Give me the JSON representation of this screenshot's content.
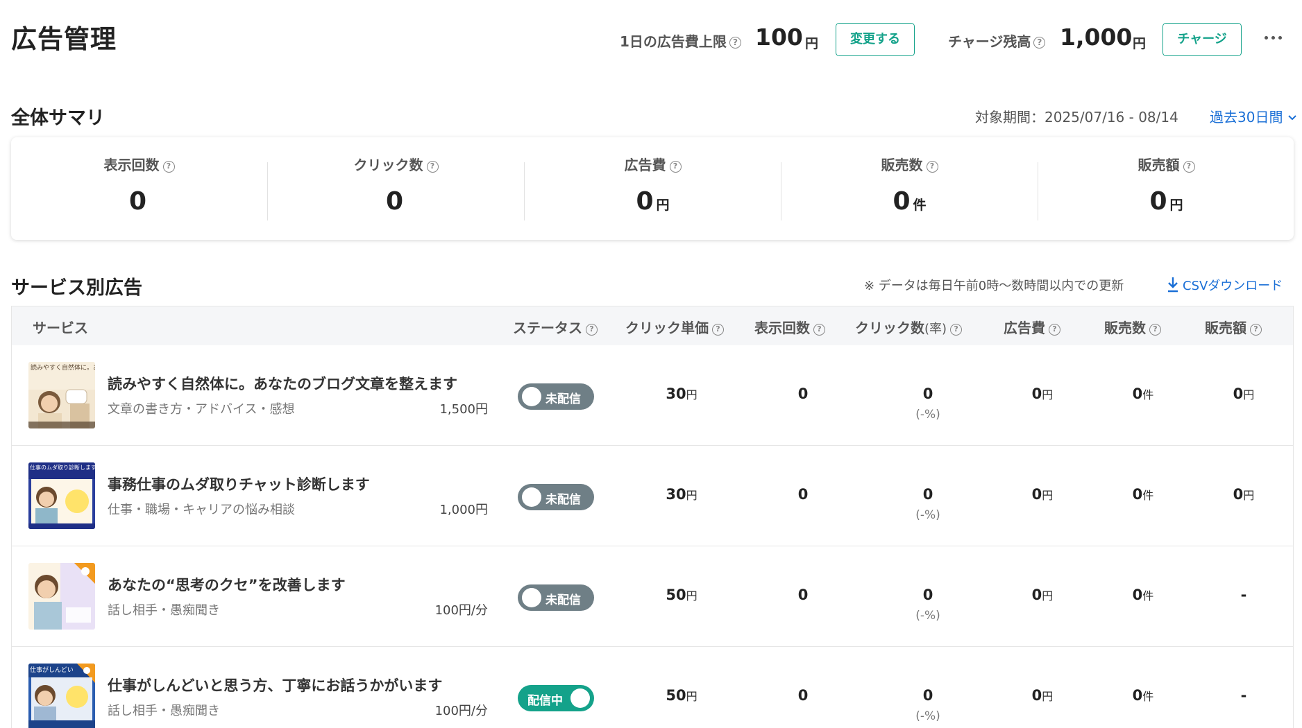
{
  "header": {
    "title": "広告管理",
    "daily_limit_label": "1日の広告費上限",
    "daily_limit_value": "100",
    "daily_limit_unit": "円",
    "change_button": "変更する",
    "balance_label": "チャージ残高",
    "balance_value": "1,000",
    "balance_unit": "円",
    "charge_button": "チャージ"
  },
  "summary": {
    "title": "全体サマリ",
    "period_label": "対象期間：2025/07/16 - 08/14",
    "period_select": "過去30日間",
    "metrics": [
      {
        "label": "表示回数",
        "value": "0",
        "unit": ""
      },
      {
        "label": "クリック数",
        "value": "0",
        "unit": ""
      },
      {
        "label": "広告費",
        "value": "0",
        "unit": "円"
      },
      {
        "label": "販売数",
        "value": "0",
        "unit": "件"
      },
      {
        "label": "販売額",
        "value": "0",
        "unit": "円"
      }
    ]
  },
  "ads": {
    "title": "サービス別広告",
    "note": "※ データは毎日午前0時〜数時間以内での更新",
    "csv_label": "CSVダウンロード",
    "columns": {
      "service": "サービス",
      "status": "ステータス",
      "cpc": "クリック単価",
      "impressions": "表示回数",
      "clicks": "クリック数",
      "clicks_rate": "(率)",
      "cost": "広告費",
      "sales_count": "販売数",
      "sales_amount": "販売額"
    },
    "rows": [
      {
        "title": "読みやすく自然体に。あなたのブログ文章を整えます",
        "category": "文章の書き方・アドバイス・感想",
        "price": "1,500円",
        "thumb_text": "読みやすく自然体に。あなたのブログ文章を整えます",
        "status": "未配信",
        "status_on": false,
        "cpc": "30",
        "cpc_unit": "円",
        "impressions": "0",
        "clicks": "0",
        "rate": "(-%)",
        "cost": "0",
        "cost_unit": "円",
        "sales_count": "0",
        "sales_count_unit": "件",
        "sales_amount": "0",
        "sales_amount_unit": "円"
      },
      {
        "title": "事務仕事のムダ取りチャット診断します",
        "category": "仕事・職場・キャリアの悩み相談",
        "price": "1,000円",
        "thumb_text": "仕事のムダ取り診断します",
        "status": "未配信",
        "status_on": false,
        "cpc": "30",
        "cpc_unit": "円",
        "impressions": "0",
        "clicks": "0",
        "rate": "(-%)",
        "cost": "0",
        "cost_unit": "円",
        "sales_count": "0",
        "sales_count_unit": "件",
        "sales_amount": "0",
        "sales_amount_unit": "円"
      },
      {
        "title": "あなたの“思考のクセ”を改善します",
        "category": "話し相手・愚痴聞き",
        "price": "100円/分",
        "thumb_text": "",
        "status": "未配信",
        "status_on": false,
        "cpc": "50",
        "cpc_unit": "円",
        "impressions": "0",
        "clicks": "0",
        "rate": "(-%)",
        "cost": "0",
        "cost_unit": "円",
        "sales_count": "0",
        "sales_count_unit": "件",
        "sales_amount": "-",
        "sales_amount_unit": ""
      },
      {
        "title": "仕事がしんどいと思う方、丁寧にお話うかがいます",
        "category": "話し相手・愚痴聞き",
        "price": "100円/分",
        "thumb_text": "仕事がしんどい",
        "status": "配信中",
        "status_on": true,
        "cpc": "50",
        "cpc_unit": "円",
        "impressions": "0",
        "clicks": "0",
        "rate": "(-%)",
        "cost": "0",
        "cost_unit": "円",
        "sales_count": "0",
        "sales_count_unit": "件",
        "sales_amount": "-",
        "sales_amount_unit": ""
      }
    ]
  },
  "colors": {
    "accent": "#14a28a",
    "link": "#1a6fd6",
    "toggle_off": "#6f7f86"
  }
}
